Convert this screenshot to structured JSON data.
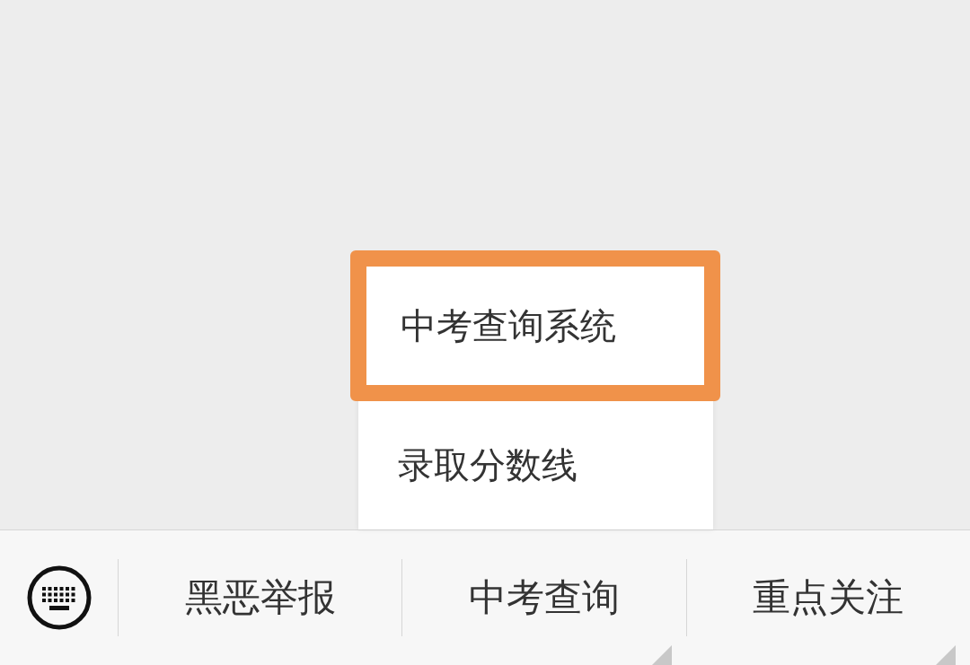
{
  "popup_menu": {
    "items": [
      {
        "label": "中考查询系统",
        "highlighted": true
      },
      {
        "label": "录取分数线",
        "highlighted": false
      }
    ]
  },
  "bottom_menu": {
    "tabs": [
      {
        "label": "黑恶举报",
        "has_submenu": false
      },
      {
        "label": "中考查询",
        "has_submenu": true
      },
      {
        "label": "重点关注",
        "has_submenu": true
      }
    ]
  }
}
